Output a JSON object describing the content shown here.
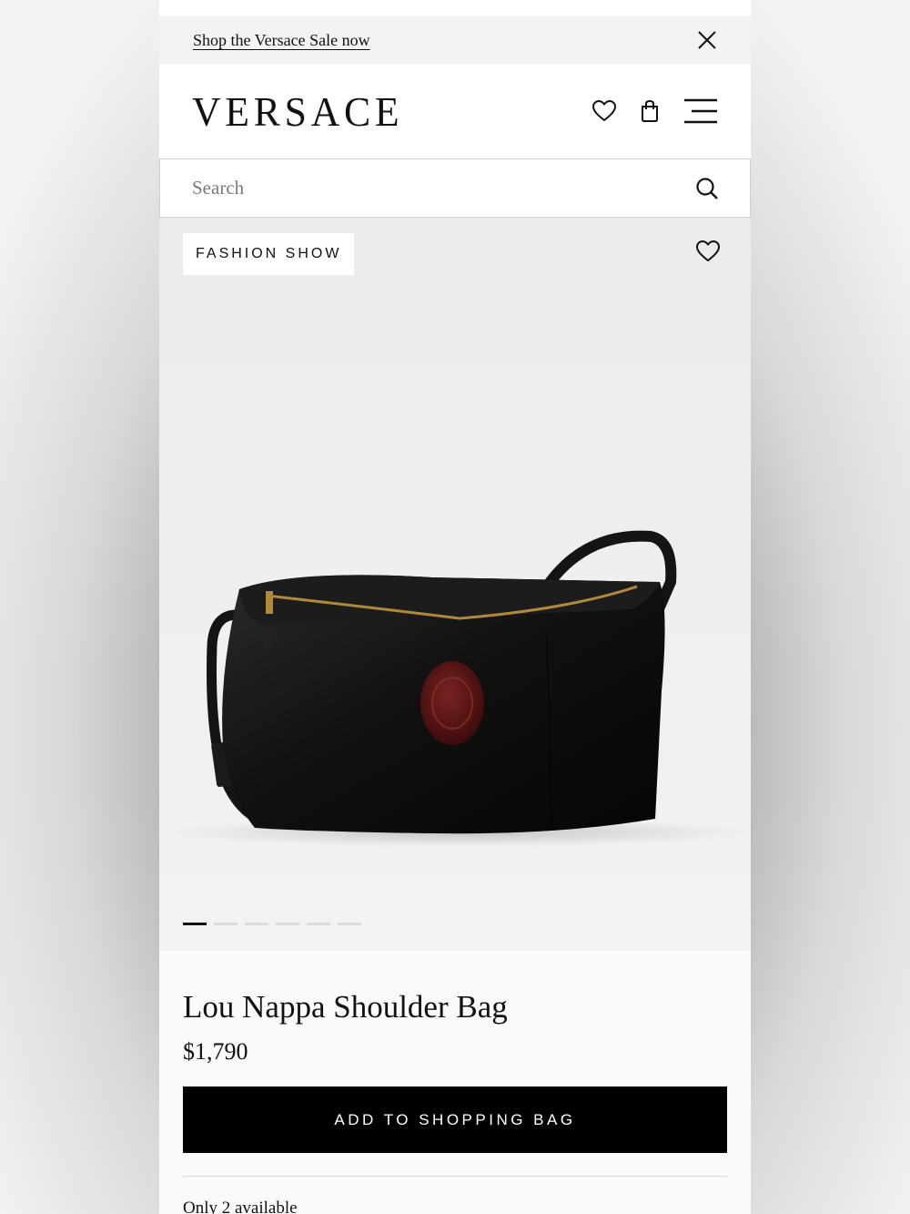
{
  "promo": {
    "link_text": "Shop the Versace Sale now"
  },
  "header": {
    "logo": "VERSACE"
  },
  "search": {
    "placeholder": "Search"
  },
  "media": {
    "badge": "FASHION SHOW",
    "carousel": {
      "total": 6,
      "active_index": 0
    }
  },
  "product": {
    "title": "Lou Nappa Shoulder Bag",
    "price": "$1,790",
    "add_button": "ADD TO SHOPPING BAG",
    "availability": "Only 2 available"
  },
  "colors": {
    "bag": "#111111",
    "medallion": "#5a1212",
    "zipper": "#b08a3a",
    "button": "#000000"
  }
}
